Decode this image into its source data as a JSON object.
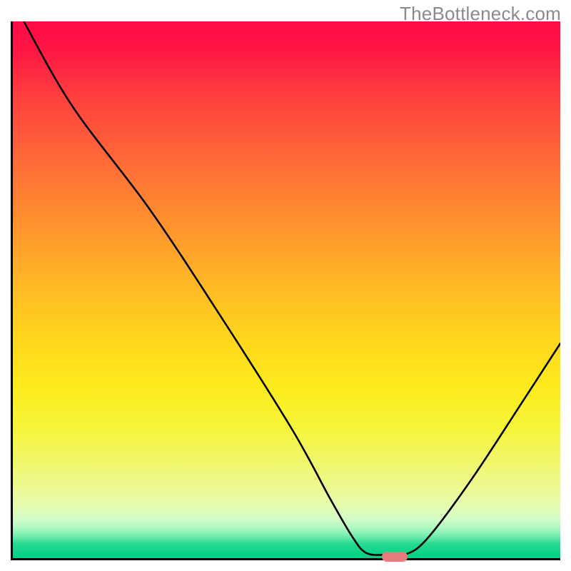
{
  "watermark": "TheBottleneck.com",
  "chart_data": {
    "type": "line",
    "title": "",
    "xlabel": "",
    "ylabel": "",
    "xlim": [
      0,
      100
    ],
    "ylim": [
      0,
      100
    ],
    "grid": false,
    "legend": false,
    "background_gradient": {
      "direction": "vertical",
      "stops": [
        {
          "pct": 0,
          "color": "#ff0a47"
        },
        {
          "pct": 50,
          "color": "#ffb526"
        },
        {
          "pct": 80,
          "color": "#f6f53b"
        },
        {
          "pct": 100,
          "color": "#00cf82"
        }
      ]
    },
    "series": [
      {
        "name": "curve",
        "color": "#000000",
        "points": [
          {
            "x": 2.0,
            "y": 100.0
          },
          {
            "x": 11.0,
            "y": 84.0
          },
          {
            "x": 25.0,
            "y": 65.0
          },
          {
            "x": 38.0,
            "y": 45.0
          },
          {
            "x": 51.0,
            "y": 24.0
          },
          {
            "x": 58.0,
            "y": 11.0
          },
          {
            "x": 62.0,
            "y": 4.0
          },
          {
            "x": 64.5,
            "y": 1.0
          },
          {
            "x": 68.0,
            "y": 0.6
          },
          {
            "x": 72.0,
            "y": 0.8
          },
          {
            "x": 76.0,
            "y": 4.0
          },
          {
            "x": 84.0,
            "y": 15.0
          },
          {
            "x": 93.0,
            "y": 29.0
          },
          {
            "x": 100.0,
            "y": 40.0
          }
        ]
      }
    ],
    "marker": {
      "x": 69.5,
      "y": 0.6,
      "color": "#e77b7d",
      "shape": "pill"
    }
  }
}
